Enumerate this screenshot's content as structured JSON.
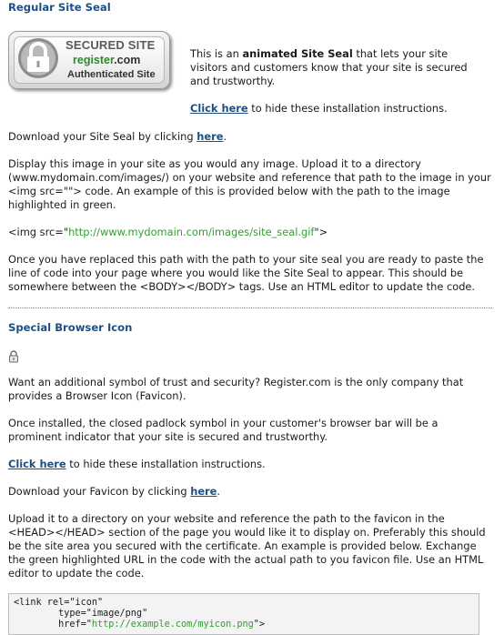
{
  "seal_section": {
    "title": "Regular Site Seal",
    "seal_line1": "SECURED SITE",
    "seal_line2_domain": "register",
    "seal_line2_tld": ".com",
    "seal_line3": "Authenticated Site",
    "desc_pre": "This is an ",
    "desc_bold": "animated Site Seal",
    "desc_post": " that lets your site visitors and customers know that your site is secured and trustworthy.",
    "hide_link": "Click here",
    "hide_post": " to hide these installation instructions.",
    "download_pre": "Download your Site Seal by clicking ",
    "download_link": "here",
    "download_post": ".",
    "display_text": "Display this image in your site as you would any image. Upload it to a directory (www.mydomain.com/images/) on your website and reference that path to the image in your <img src=\"\"> code. An example of this is provided below with the path to the image highlighted in green.",
    "img_pre": "<img src=\"",
    "img_url": "http://www.mydomain.com/images/site_seal.gif",
    "img_post": "\">",
    "replaced_text": "Once you have replaced this path with the path to your site seal you are ready to paste the line of code into your page where you would like the Site Seal to appear. This should be somewhere between the <BODY></BODY> tags. Use an HTML editor to update the code."
  },
  "icon_section": {
    "title": "Special Browser Icon",
    "want_text": "Want an additional symbol of trust and security? Register.com is the only company that provides a Browser Icon (Favicon).",
    "installed_text": "Once installed, the closed padlock symbol in your customer's browser bar will be a prominent indicator that your site is secured and trustworthy.",
    "hide_link": "Click here",
    "hide_post": " to hide these installation instructions.",
    "download_pre": "Download your Favicon by clicking ",
    "download_link": "here",
    "download_post": ".",
    "upload_text": "Upload it to a directory on your website and reference the path to the favicon in the <HEAD></HEAD> section of the page you would like it to display on. Preferably this should be the site area you secured with the certificate. An example is provided below. Exchange the green highlighted URL in the code with the actual path to you favicon file. Use an HTML editor to update the code.",
    "code_line1": "<link rel=\"icon\"",
    "code_line2": "        type=\"image/png\"",
    "code_line3_pre": "        href=\"",
    "code_line3_url": "http://example.com/myicon.png",
    "code_line3_post": "\">"
  },
  "colors": {
    "link": "#1d4f83",
    "highlight_green": "#2f9f2f"
  }
}
